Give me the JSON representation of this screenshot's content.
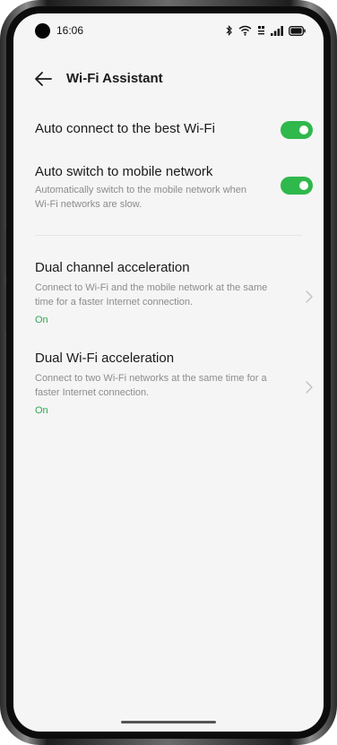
{
  "status_bar": {
    "time": "16:06",
    "icons": [
      "bluetooth-icon",
      "wifi-icon",
      "mobile-data-icon",
      "signal-icon",
      "battery-icon"
    ]
  },
  "header": {
    "back_icon": "back-arrow-icon",
    "title": "Wi-Fi Assistant"
  },
  "settings": {
    "auto_connect": {
      "title": "Auto connect to the best Wi-Fi",
      "enabled": true
    },
    "auto_switch": {
      "title": "Auto switch to mobile network",
      "description": "Automatically switch to the mobile network when Wi-Fi networks are slow.",
      "enabled": true
    },
    "dual_channel": {
      "title": "Dual channel acceleration",
      "description": "Connect to Wi-Fi and the mobile network at the same time for a faster Internet connection.",
      "status": "On"
    },
    "dual_wifi": {
      "title": "Dual Wi-Fi acceleration",
      "description": "Connect to two Wi-Fi networks at the same time for a faster Internet connection.",
      "status": "On"
    }
  },
  "colors": {
    "accent": "#2fb84c",
    "status_text": "#2fa84f",
    "background": "#f5f5f5"
  }
}
